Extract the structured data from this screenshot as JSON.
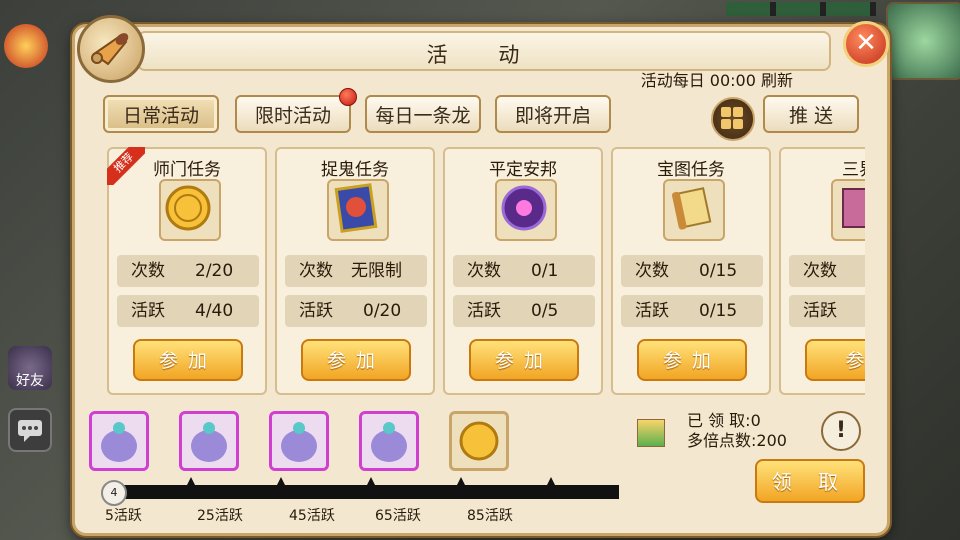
{
  "window": {
    "title": "活 动",
    "refresh_note": "活动每日 00:00 刷新"
  },
  "tabs": [
    {
      "label": "日常活动",
      "active": true
    },
    {
      "label": "限时活动",
      "has_alert": true
    },
    {
      "label": "每日一条龙"
    },
    {
      "label": "即将开启"
    }
  ],
  "push_label": "推 送",
  "side": {
    "friends_label": "好友"
  },
  "cards": [
    {
      "name": "师门任务",
      "badge": "推荐",
      "icon": "gold-coin-icon",
      "count_label": "次数",
      "count": "2/20",
      "active_label": "活跃",
      "active": "4/40",
      "join": "参加"
    },
    {
      "name": "捉鬼任务",
      "icon": "ghost-card-icon",
      "count_label": "次数",
      "count": "无限制",
      "active_label": "活跃",
      "active": "0/20",
      "join": "参加"
    },
    {
      "name": "平定安邦",
      "icon": "purple-orb-icon",
      "count_label": "次数",
      "count": "0/1",
      "active_label": "活跃",
      "active": "0/5",
      "join": "参加"
    },
    {
      "name": "宝图任务",
      "icon": "scroll-map-icon",
      "count_label": "次数",
      "count": "0/15",
      "active_label": "活跃",
      "active": "0/15",
      "join": "参加"
    },
    {
      "name": "三界",
      "icon": "book-icon",
      "count_label": "次数",
      "count": "",
      "active_label": "活跃",
      "active": "",
      "join": "参"
    }
  ],
  "rewards": {
    "milestones": [
      "5活跃",
      "25活跃",
      "45活跃",
      "65活跃",
      "85活跃"
    ],
    "current_activity": "4",
    "claimed_label": "已 领 取:0",
    "multiplier_label": "多倍点数:200",
    "claim_button": "领 取"
  },
  "colors": {
    "accent": "#f2a524",
    "panel": "#f3e7cf",
    "chest_border": "#d13fd1"
  }
}
